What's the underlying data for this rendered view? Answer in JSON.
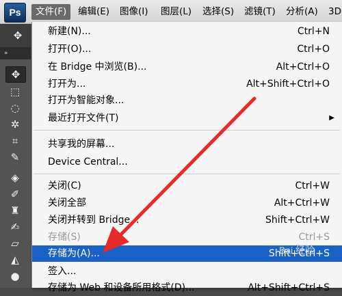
{
  "app": {
    "logo": "Ps"
  },
  "menubar": {
    "items": [
      {
        "label": "文件(F)",
        "active": true
      },
      {
        "label": "编辑(E)"
      },
      {
        "label": "图像(I)"
      },
      {
        "label": "图层(L)"
      },
      {
        "label": "选择(S)"
      },
      {
        "label": "滤镜(T)"
      },
      {
        "label": "分析(A)"
      },
      {
        "label": "3D"
      }
    ]
  },
  "toolbox": {
    "tools": [
      "move-tool",
      "marquee-tool",
      "lasso-tool",
      "magic-wand-tool",
      "crop-tool",
      "eyedropper-tool",
      "healing-brush-tool",
      "brush-tool",
      "clone-stamp-tool",
      "history-brush-tool",
      "eraser-tool",
      "paint-bucket-tool",
      "blur-tool"
    ]
  },
  "file_menu": {
    "items": [
      {
        "label": "新建(N)...",
        "shortcut": "Ctrl+N"
      },
      {
        "label": "打开(O)...",
        "shortcut": "Ctrl+O"
      },
      {
        "label": "在 Bridge 中浏览(B)...",
        "shortcut": "Alt+Ctrl+O"
      },
      {
        "label": "打开为...",
        "shortcut": "Alt+Shift+Ctrl+O"
      },
      {
        "label": "打开为智能对象..."
      },
      {
        "label": "最近打开文件(T)",
        "submenu": true
      },
      {
        "label": "共享我的屏幕..."
      },
      {
        "label": "Device Central..."
      },
      {
        "label": "关闭(C)",
        "shortcut": "Ctrl+W"
      },
      {
        "label": "关闭全部",
        "shortcut": "Alt+Ctrl+W"
      },
      {
        "label": "关闭并转到 Bridge...",
        "shortcut": "Shift+Ctrl+W"
      },
      {
        "label": "存储(S)",
        "shortcut": "Ctrl+S",
        "disabled": true
      },
      {
        "label": "存储为(A)...",
        "shortcut": "Shift+Ctrl+S",
        "highlighted": true
      },
      {
        "label": "签入..."
      },
      {
        "label": "存储为 Web 和设备所用格式(D)...",
        "shortcut": "Alt+Shift+Ctrl+S"
      }
    ],
    "submenu_glyph": "▶"
  },
  "watermark": "Bai 经验",
  "colors": {
    "highlight": "#1c62c6",
    "arrow": "#e82a2a"
  }
}
